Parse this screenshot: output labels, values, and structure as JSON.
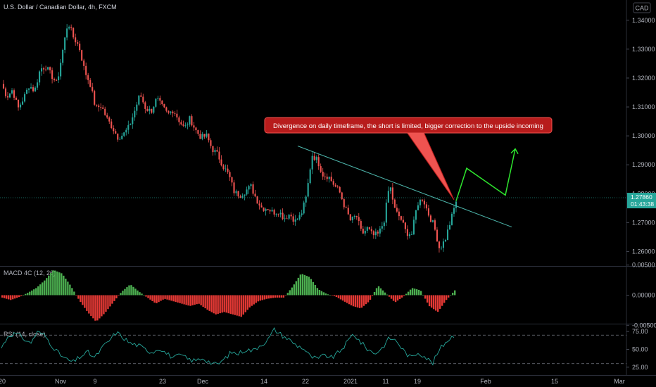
{
  "header": {
    "symbol_title": "U.S. Dollar / Canadian Dollar, 4h, FXCM",
    "currency_badge": "CAD"
  },
  "annotation": {
    "text": "Divergence on daily timeframe, the short is limited, bigger correction to the upside incoming",
    "color": "#b71c1c"
  },
  "colors": {
    "up": "#26a69a",
    "down": "#ef5350",
    "macd_pos": "#4caf50",
    "macd_neg": "#e53935",
    "rsi_line": "#26a69a",
    "projection": "#2ee62e",
    "trendline": "#4db6ac"
  },
  "price_axis": {
    "ticks": [
      "1.34000",
      "1.33000",
      "1.32000",
      "1.31000",
      "1.30000",
      "1.29000",
      "1.28000",
      "1.27000",
      "1.26000"
    ]
  },
  "price_labels": {
    "last_price": "1.27860",
    "countdown": "01:43:38"
  },
  "macd": {
    "title": "MACD 4C (12, 26)",
    "ticks": [
      "0.00500",
      "0.00000",
      "-0.00500"
    ]
  },
  "rsi": {
    "title": "RSI (14, close)",
    "ticks": [
      "75.00",
      "50.00",
      "25.00"
    ]
  },
  "time_axis": {
    "labels": [
      "20",
      "Nov",
      "9",
      "23",
      "Dec",
      "14",
      "22",
      "2021",
      "11",
      "19",
      "Feb",
      "15",
      "Mar"
    ]
  },
  "chart_data": {
    "type": "candlestick",
    "title": "U.S. Dollar / Canadian Dollar, 4h, FXCM",
    "ylim": [
      1.255,
      1.347
    ],
    "close_path": [
      1.318,
      1.3135,
      1.316,
      1.3095,
      1.313,
      1.3175,
      1.3155,
      1.3232,
      1.324,
      1.321,
      1.318,
      1.329,
      1.3395,
      1.334,
      1.331,
      1.3225,
      1.318,
      1.3095,
      1.3105,
      1.306,
      1.303,
      1.2995,
      1.3005,
      1.303,
      1.3085,
      1.3145,
      1.3095,
      1.3085,
      1.313,
      1.31,
      1.3075,
      1.309,
      1.3055,
      1.3025,
      1.306,
      1.302,
      1.2995,
      1.3,
      1.2955,
      1.2935,
      1.2895,
      1.2865,
      1.2805,
      1.2795,
      1.281,
      1.2825,
      1.278,
      1.275,
      1.275,
      1.2735,
      1.274,
      1.2715,
      1.273,
      1.2705,
      1.2725,
      1.279,
      1.2935,
      1.2915,
      1.2865,
      1.286,
      1.283,
      1.2805,
      1.275,
      1.2705,
      1.2725,
      1.266,
      1.268,
      1.2655,
      1.266,
      1.2705,
      1.2835,
      1.274,
      1.2715,
      1.2665,
      1.266,
      1.2765,
      1.2785,
      1.273,
      1.269,
      1.261,
      1.264,
      1.2705,
      1.2775
    ],
    "projection": [
      1.2775,
      1.2888,
      1.2795,
      1.2955
    ],
    "trendline": [
      1.2965,
      1.2685
    ],
    "macd": {
      "ylim": [
        -0.0045,
        0.0045
      ],
      "values": [
        -0.0004,
        -0.0008,
        -0.0003,
        0.0004,
        0.0012,
        0.0025,
        0.0042,
        0.0036,
        0.0016,
        -0.0008,
        -0.0028,
        -0.0044,
        -0.003,
        -0.0012,
        0.0006,
        0.0018,
        0.0006,
        -0.0004,
        -0.0014,
        -0.0006,
        -0.001,
        -0.0014,
        -0.0018,
        -0.0014,
        -0.0024,
        -0.0032,
        -0.0028,
        -0.0032,
        -0.0036,
        -0.002,
        -0.001,
        -0.0006,
        -0.0004,
        -0.0004,
        0.0014,
        0.0036,
        0.003,
        0.001,
        0.0002,
        -0.0002,
        -0.001,
        -0.0018,
        -0.0022,
        -0.001,
        0.0016,
        0.0002,
        -0.0012,
        -0.0002,
        0.0012,
        0.0008,
        -0.0018,
        -0.0028,
        -0.0008,
        0.0008
      ]
    },
    "rsi": {
      "ylim": [
        15,
        85
      ],
      "bands": [
        70,
        30
      ],
      "values": [
        52,
        70,
        72,
        66,
        58,
        74,
        70,
        56,
        44,
        36,
        32,
        40,
        46,
        38,
        52,
        62,
        74,
        66,
        58,
        56,
        50,
        46,
        52,
        44,
        38,
        42,
        36,
        34,
        38,
        32,
        28,
        36,
        46,
        44,
        50,
        48,
        56,
        62,
        78,
        70,
        64,
        56,
        52,
        40,
        36,
        42,
        38,
        46,
        58,
        72,
        60,
        50,
        44,
        52,
        66,
        62,
        48,
        38,
        46,
        40,
        30,
        50,
        62,
        70
      ]
    }
  }
}
